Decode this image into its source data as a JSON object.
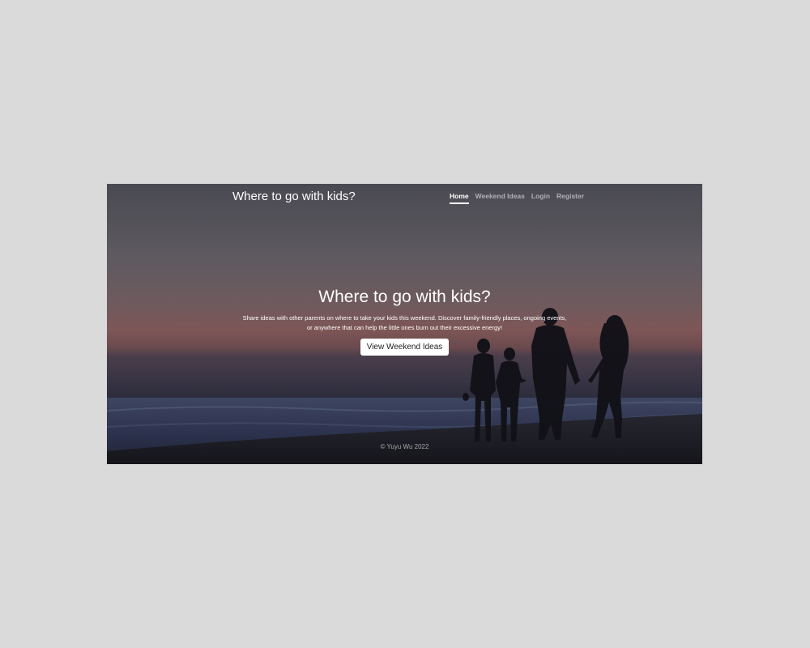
{
  "navbar": {
    "brand": "Where to go with kids?",
    "links": [
      {
        "label": "Home",
        "active": true
      },
      {
        "label": "Weekend Ideas",
        "active": false
      },
      {
        "label": "Login",
        "active": false
      },
      {
        "label": "Register",
        "active": false
      }
    ]
  },
  "hero": {
    "title": "Where to go with kids?",
    "text": "Share ideas with other parents on where to take your kids this weekend. Discover family-friendly places, ongoing events, or anywhere that can help the little ones burn out their excessive energy!",
    "button_label": "View Weekend Ideas",
    "background": "family-silhouette-beach-sunset"
  },
  "footer": {
    "text": "© Yuyu Wu 2022"
  },
  "colors": {
    "page_background": "#dadada",
    "sky_top": "#55555c",
    "sky_horizon": "#8a5a58",
    "sea": "#3a3f58",
    "text": "#ffffff"
  }
}
